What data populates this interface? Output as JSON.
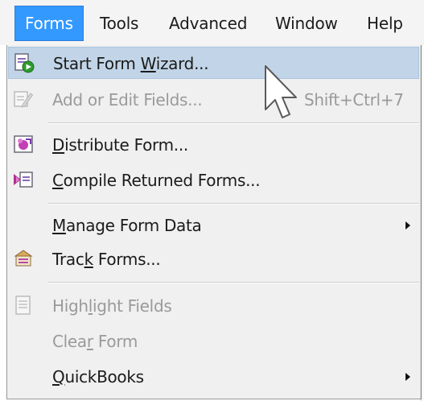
{
  "menubar": {
    "items": [
      {
        "label": "Forms",
        "active": true
      },
      {
        "label": "Tools"
      },
      {
        "label": "Advanced"
      },
      {
        "label": "Window"
      },
      {
        "label": "Help"
      }
    ]
  },
  "dropdown": {
    "items": [
      {
        "pre": "Start Form ",
        "mn": "W",
        "post": "izard...",
        "icon": "form-wizard-icon",
        "highlighted": true
      },
      {
        "pre": "Add or Edit Fields...",
        "mn": "",
        "post": "",
        "icon": "edit-fields-icon",
        "disabled": true,
        "shortcut": "Shift+Ctrl+7"
      },
      {
        "pre": "",
        "mn": "D",
        "post": "istribute Form...",
        "icon": "distribute-form-icon"
      },
      {
        "pre": "",
        "mn": "C",
        "post": "ompile Returned Forms...",
        "icon": "compile-forms-icon"
      },
      {
        "pre": "",
        "mn": "M",
        "post": "anage Form Data",
        "submenu": true
      },
      {
        "pre": "Trac",
        "mn": "k",
        "post": " Forms...",
        "icon": "track-forms-icon"
      },
      {
        "pre": "High",
        "mn": "l",
        "post": "ight Fields",
        "icon": "highlight-fields-icon",
        "disabled": true
      },
      {
        "pre": "Clea",
        "mn": "r",
        "post": " Form",
        "disabled": true
      },
      {
        "pre": "",
        "mn": "Q",
        "post": "uickBooks",
        "submenu": true
      }
    ]
  },
  "colors": {
    "active_menu_bg": "#3399ff",
    "highlight_bg": "#c2d5e8",
    "disabled_text": "#9a9a9a",
    "menu_bg": "#f0f0f0"
  }
}
